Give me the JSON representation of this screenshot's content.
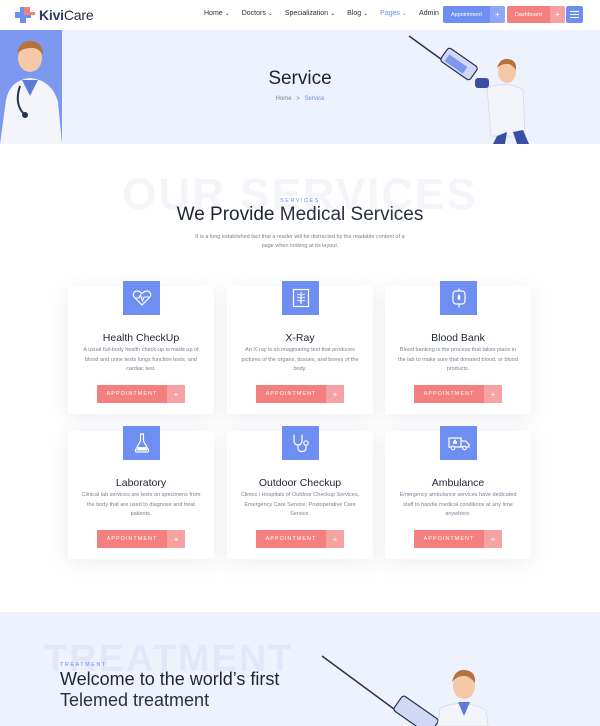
{
  "header": {
    "logo_text_bold": "Kivi",
    "logo_text_rest": "Care",
    "nav": [
      {
        "label": "Home",
        "has_dropdown": true,
        "active": false
      },
      {
        "label": "Doctors",
        "has_dropdown": true,
        "active": false
      },
      {
        "label": "Specialization",
        "has_dropdown": true,
        "active": false
      },
      {
        "label": "Blog",
        "has_dropdown": true,
        "active": false
      },
      {
        "label": "Pages",
        "has_dropdown": true,
        "active": true
      },
      {
        "label": "Admin",
        "has_dropdown": false,
        "active": false
      }
    ],
    "appointment_label": "Appointment",
    "dashboard_label": "Dashboard",
    "plus": "+"
  },
  "banner": {
    "title": "Service",
    "breadcrumb_home": "Home",
    "breadcrumb_sep": ">",
    "breadcrumb_current": "Service"
  },
  "services": {
    "ghost_text": "OUR SERVICES",
    "eyebrow": "SERVICES",
    "title_bold": "We Provide",
    "title_light": "Medical Services",
    "description": "It is a long established fact that a reader will be distracted by the readable content of a page when looking at its layout.",
    "cards": [
      {
        "icon": "heart-pulse-icon",
        "title": "Health CheckUp",
        "text": "A usual full-body health check-up is made up of blood and urine tests lungs function tests, and cardiac test.",
        "button": "APPOINTMENT"
      },
      {
        "icon": "xray-icon",
        "title": "X-Ray",
        "text": "An X-ray is an imaginaring test that produces pictures of the organs, tissues, and bones of the body.",
        "button": "APPOINTMENT"
      },
      {
        "icon": "blood-bag-icon",
        "title": "Blood Bank",
        "text": "Blood banking is the process that takes place in the lab to make sure that donated blood, or blood products.",
        "button": "APPOINTMENT"
      },
      {
        "icon": "flask-icon",
        "title": "Laboratory",
        "text": "Clinical lab services are tests on specimens from the body that are used to diagnose and treat patients.",
        "button": "APPOINTMENT"
      },
      {
        "icon": "stethoscope-icon",
        "title": "Outdoor Checkup",
        "text": "Clinics / Hospitals of Outdoor Checkup Services, Emergency Care Service, Postoperative Care Service.",
        "button": "APPOINTMENT"
      },
      {
        "icon": "ambulance-icon",
        "title": "Ambulance",
        "text": "Emergency ambulance services have dedicated staff to handle medical conditions at any time anywhere.",
        "button": "APPOINTMENT"
      }
    ],
    "plus": "+"
  },
  "treatment": {
    "ghost_text": "TREATMENT",
    "eyebrow": "TREATMENT",
    "title_line1": "Welcome to the world’s first",
    "title_line2": "Telemed treatment"
  },
  "colors": {
    "primary_blue": "#6f8ef2",
    "coral": "#f47f7f",
    "banner_bg": "#eef2fd"
  }
}
